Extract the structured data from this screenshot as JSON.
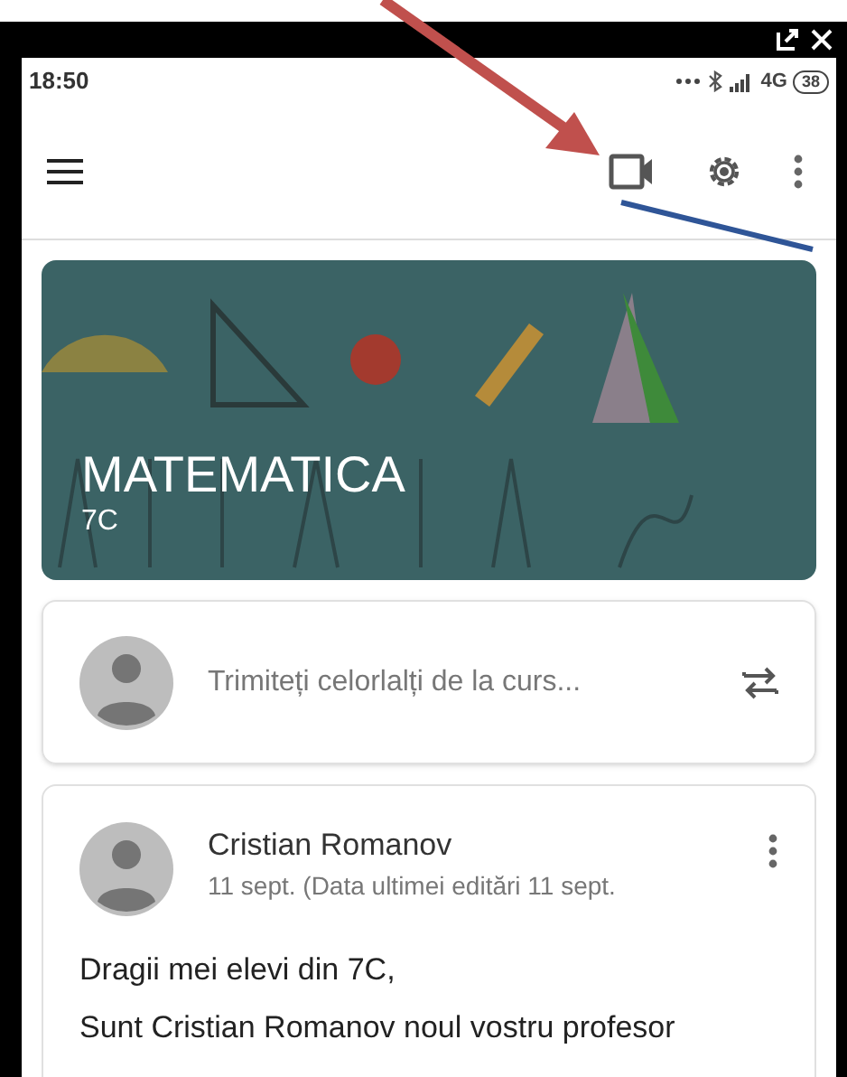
{
  "status_bar": {
    "time": "18:50",
    "network": "4G",
    "battery": "38"
  },
  "class_banner": {
    "title": "MATEMATICA",
    "section": "7C",
    "kind": "picture"
  },
  "compose": {
    "placeholder": "Trimiteți celorlalți de la curs..."
  },
  "post": {
    "author": "Cristian Romanov",
    "date": "11 sept. (Data ultimei editări 11 sept.",
    "body": [
      "Dragii mei elevi din 7C,",
      "Sunt Cristian Romanov noul vostru profesor"
    ]
  }
}
